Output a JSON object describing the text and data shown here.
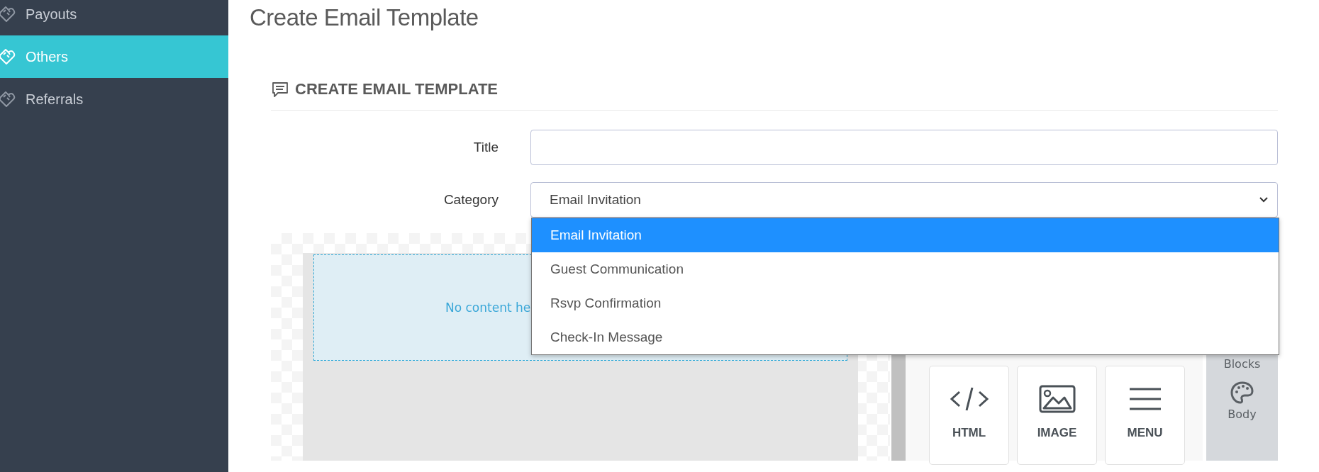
{
  "sidebar": {
    "items": [
      {
        "label": "Payouts",
        "selected": false
      },
      {
        "label": "Others",
        "selected": true
      },
      {
        "label": "Referrals",
        "selected": false
      }
    ]
  },
  "page_title": "Create Email Template",
  "card": {
    "heading": "CREATE EMAIL TEMPLATE",
    "fields": [
      {
        "kind": "text",
        "label": "Title"
      },
      {
        "kind": "select",
        "label": "Category",
        "value": "Email Invitation",
        "expanded": true,
        "options": [
          {
            "label": "Email Invitation",
            "selected": true
          },
          {
            "label": "Guest Communication",
            "selected": false
          },
          {
            "label": "Rsvp Confirmation",
            "selected": false
          },
          {
            "label": "Check-In Message",
            "selected": false
          }
        ]
      }
    ]
  },
  "editor": {
    "empty_text": "No content he",
    "blocks": [
      {
        "kind": "code",
        "label": "HTML"
      },
      {
        "kind": "image",
        "label": "IMAGE"
      },
      {
        "kind": "menu",
        "label": "MENU"
      }
    ],
    "side_tabs": [
      {
        "kind": "blocks",
        "label": "Blocks"
      },
      {
        "kind": "body",
        "label": "Body"
      }
    ]
  }
}
